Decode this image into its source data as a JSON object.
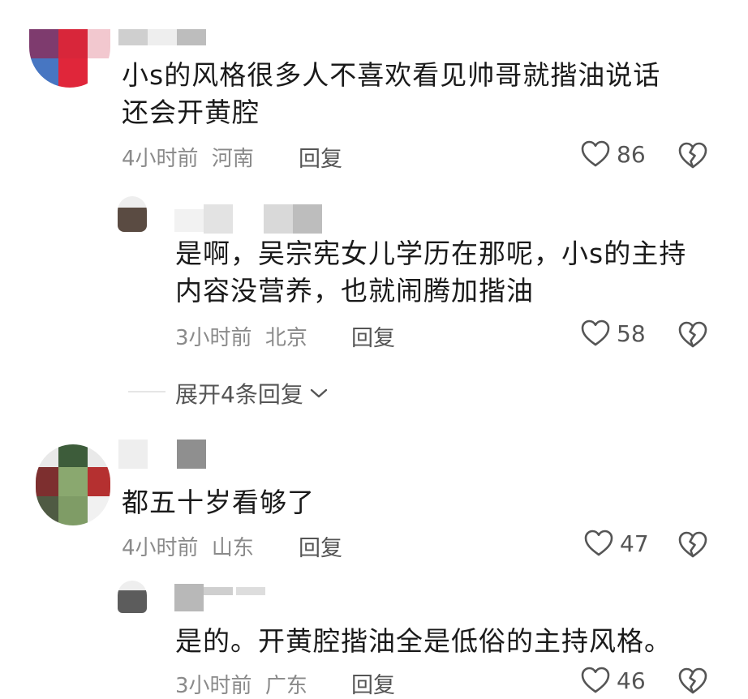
{
  "comments": [
    {
      "text_line1": "小s的风格很多人不喜欢看见帅哥就揩油说话",
      "text_line2": "还会开黄腔",
      "time": "4小时前",
      "location": "河南",
      "reply_label": "回复",
      "likes": "86",
      "replies": [
        {
          "text_line1": "是啊，吴宗宪女儿学历在那呢，小s的主持",
          "text_line2": "内容没营养，也就闹腾加揩油",
          "time": "3小时前",
          "location": "北京",
          "reply_label": "回复",
          "likes": "58"
        }
      ],
      "expand_label": "展开4条回复"
    },
    {
      "text_line1": "都五十岁看够了",
      "time": "4小时前",
      "location": "山东",
      "reply_label": "回复",
      "likes": "47",
      "replies": [
        {
          "text_line1": "是的。开黄腔揩油全是低俗的主持风格。",
          "time": "3小时前",
          "location": "广东",
          "reply_label": "回复",
          "likes": "46"
        }
      ]
    }
  ],
  "icons": {
    "like": "heart-outline-icon",
    "dislike": "broken-heart-icon",
    "expand": "chevron-down-icon"
  },
  "colors": {
    "text": "#1a1a1a",
    "meta": "#8a8a8a",
    "action": "#555555"
  }
}
